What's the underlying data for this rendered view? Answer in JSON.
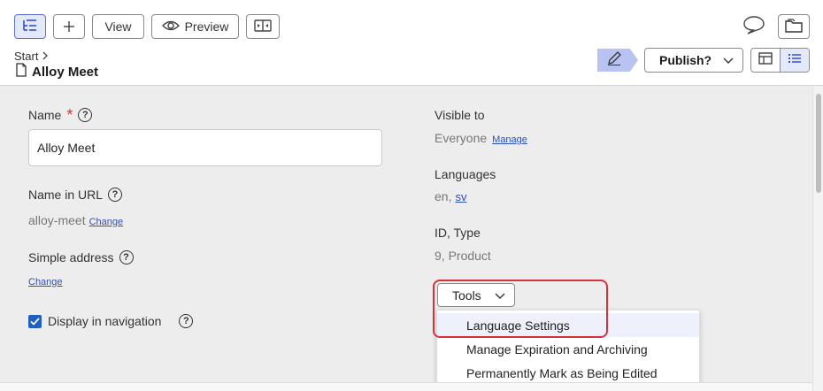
{
  "toolbar": {
    "view_label": "View",
    "preview_label": "Preview"
  },
  "header": {
    "breadcrumb_start": "Start",
    "page_title": "Alloy Meet",
    "publish_label": "Publish?"
  },
  "form": {
    "name_label": "Name",
    "name_required_mark": "*",
    "name_value": "Alloy Meet",
    "url_label": "Name in URL",
    "url_value": "alloy-meet",
    "url_change": "Change",
    "simple_address_label": "Simple address",
    "simple_address_change": "Change",
    "display_in_nav_label": "Display in navigation",
    "display_in_nav_checked": true
  },
  "info": {
    "visible_to_label": "Visible to",
    "visible_to_value": "Everyone",
    "visible_to_manage": "Manage",
    "languages_label": "Languages",
    "languages_plain": "en,",
    "languages_link": "sv",
    "id_type_label": "ID, Type",
    "id_type_value": "9, Product"
  },
  "tools": {
    "button_label": "Tools",
    "menu_items": [
      "Language Settings",
      "Manage Expiration and Archiving",
      "Permanently Mark as Being Edited"
    ]
  },
  "colors": {
    "accent": "#2d4fbd",
    "highlight": "#d9303a",
    "edit_tag": "#b8c3f2"
  }
}
